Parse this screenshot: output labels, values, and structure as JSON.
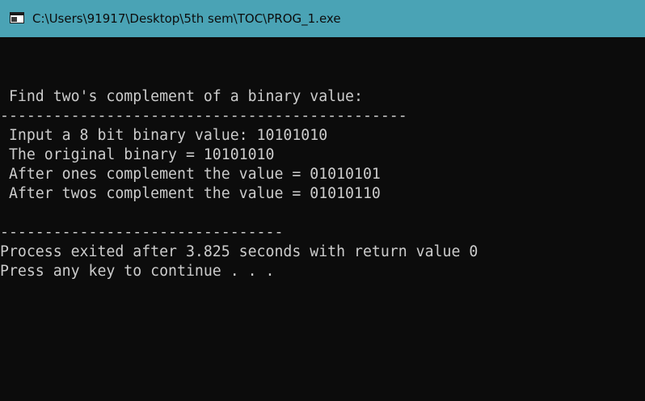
{
  "window": {
    "title": "C:\\Users\\91917\\Desktop\\5th sem\\TOC\\PROG_1.exe",
    "icon": "console-window-icon",
    "titlebar_color": "#4aa3b5",
    "console_background": "#0c0c0c",
    "console_text_color": "#cccccc"
  },
  "console": {
    "lines": [
      "",
      " Find two's complement of a binary value:",
      "----------------------------------------------",
      " Input a 8 bit binary value: 10101010",
      " The original binary = 10101010",
      " After ones complement the value = 01010101",
      " After twos complement the value = 01010110",
      "",
      "--------------------------------",
      "Process exited after 3.825 seconds with return value 0",
      "Press any key to continue . . ."
    ]
  }
}
